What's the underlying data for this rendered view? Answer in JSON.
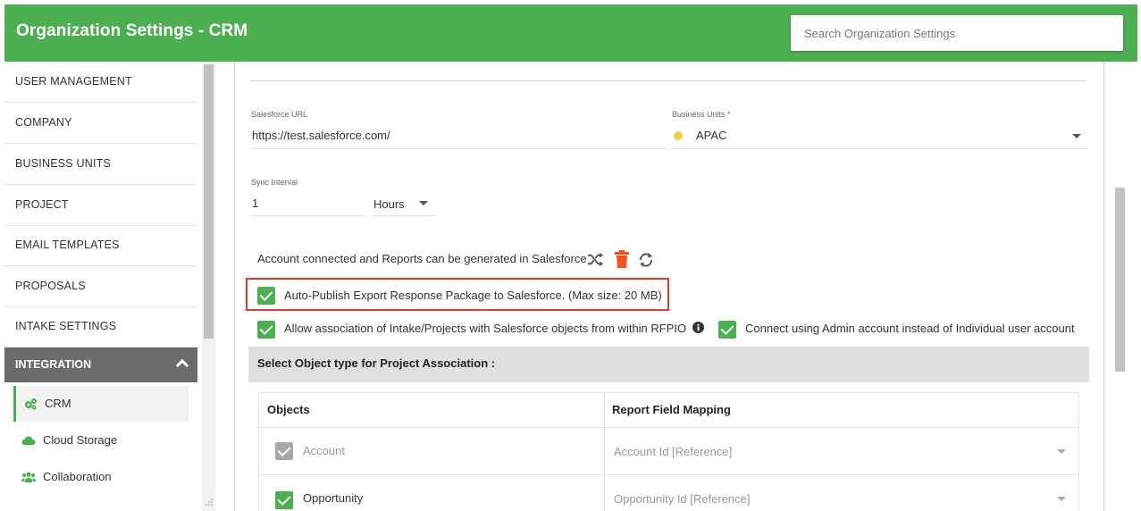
{
  "header": {
    "title": "Organization Settings - CRM",
    "search_placeholder": "Search Organization Settings"
  },
  "sidebar": {
    "items": [
      {
        "label": "USER MANAGEMENT"
      },
      {
        "label": "COMPANY"
      },
      {
        "label": "BUSINESS UNITS"
      },
      {
        "label": "PROJECT"
      },
      {
        "label": "EMAIL TEMPLATES"
      },
      {
        "label": "PROPOSALS"
      },
      {
        "label": "INTAKE SETTINGS"
      }
    ],
    "active_section": "INTEGRATION",
    "sub_items": [
      {
        "label": "CRM",
        "icon": "gears-icon",
        "selected": true
      },
      {
        "label": "Cloud Storage",
        "icon": "cloud-icon",
        "selected": false
      },
      {
        "label": "Collaboration",
        "icon": "users-icon",
        "selected": false
      }
    ]
  },
  "form": {
    "salesforce_url_label": "Salesforce URL",
    "salesforce_url_value": "https://test.salesforce.com/",
    "business_units_label": "Business Units *",
    "business_units_value": "APAC",
    "sync_interval_label": "Sync Interval",
    "sync_interval_value": "1",
    "sync_unit_value": "Hours",
    "status_text": "Account connected and Reports can be generated in Salesforce",
    "auto_publish_label": "Auto-Publish Export Response Package to Salesforce. (Max size: 20 MB)",
    "allow_association_label": "Allow association of Intake/Projects with Salesforce objects from within RFPIO",
    "connect_admin_label": "Connect using Admin account instead of Individual user account"
  },
  "section": {
    "title": "Select Object type for Project Association :"
  },
  "table": {
    "headers": [
      "Objects",
      "Report Field Mapping"
    ],
    "rows": [
      {
        "object": "Account",
        "mapping": "Account Id [Reference]"
      },
      {
        "object": "Opportunity",
        "mapping": "Opportunity Id [Reference]"
      }
    ]
  },
  "colors": {
    "header_bg": "#4caf50",
    "accent_green": "#4caf50",
    "delete_orange": "#f4511e",
    "highlight_red": "#e53935",
    "sidebar_active_bg": "#6b6b6b",
    "business_unit_dot": "#f4d03f"
  }
}
